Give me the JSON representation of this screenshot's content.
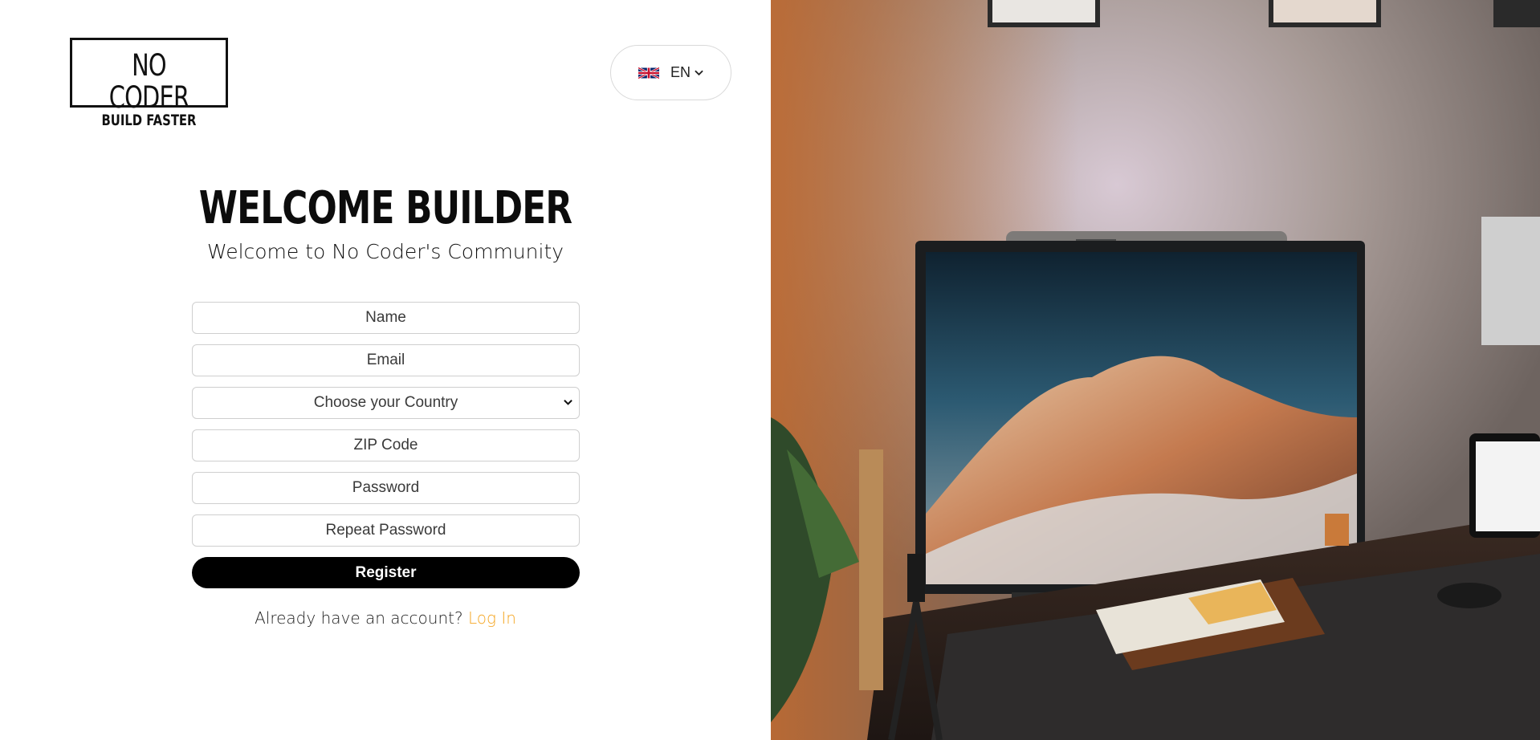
{
  "brand": {
    "line1": "NO CODER",
    "line2": "BUILD FASTER"
  },
  "language": {
    "code": "EN",
    "flag_icon": "uk-flag-icon",
    "chevron_icon": "chevron-down-icon"
  },
  "welcome": {
    "title": "WELCOME BUILDER",
    "subtitle": "Welcome to No Coder's Community"
  },
  "form": {
    "name_placeholder": "Name",
    "email_placeholder": "Email",
    "country_placeholder": "Choose your Country",
    "zip_placeholder": "ZIP Code",
    "password_placeholder": "Password",
    "repeat_password_placeholder": "Repeat Password",
    "register_label": "Register"
  },
  "login": {
    "prompt": "Already have an account?",
    "link_label": "Log In"
  },
  "colors": {
    "accent": "#f5a623",
    "button": "#000000",
    "text": "#111111"
  },
  "hero_image": {
    "icon": "desk-setup-photo"
  }
}
